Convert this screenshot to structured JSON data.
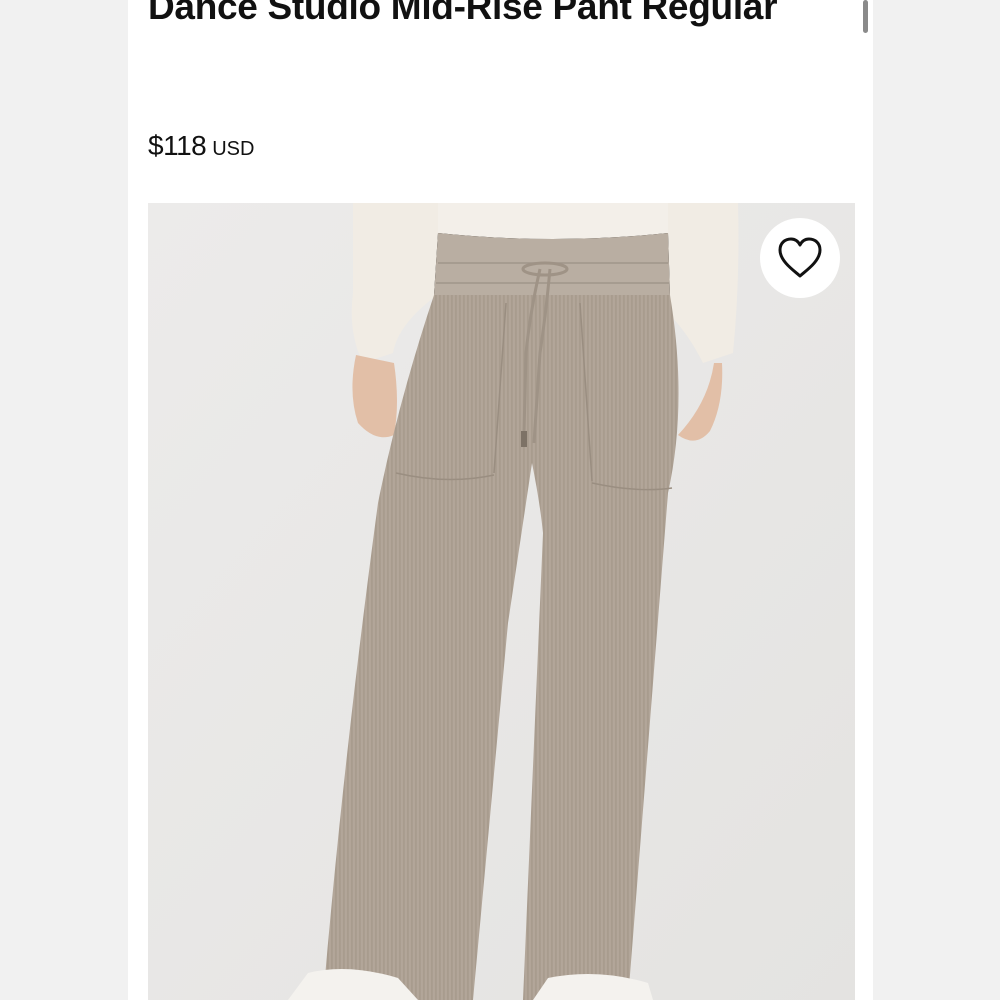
{
  "product": {
    "title": "Dance Studio Mid-Rise Pant Regular",
    "price": "$118",
    "currency": "USD"
  },
  "image": {
    "alt": "Dance Studio Mid-Rise Pant Regular",
    "wishlist_icon": "heart-outline-icon"
  },
  "colors": {
    "background": "#f4f4f4",
    "card": "#ffffff",
    "text": "#111111",
    "pant": "#b0a497"
  }
}
